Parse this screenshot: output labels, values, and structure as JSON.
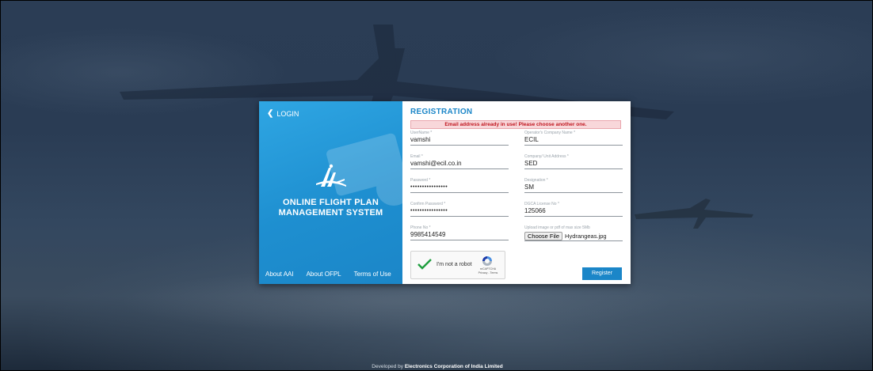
{
  "left": {
    "login_label": "LOGIN",
    "system_title_line1": "ONLINE FLIGHT PLAN",
    "system_title_line2": "MANAGEMENT SYSTEM",
    "links": [
      "About AAI",
      "About OFPL",
      "Terms of Use"
    ]
  },
  "form": {
    "title": "REGISTRATION",
    "error": "Email address already in use! Please choose another one.",
    "fields": {
      "username": {
        "label": "UserName *",
        "value": "vamshi"
      },
      "company_name": {
        "label": "Operator's Company Name *",
        "value": "ECIL"
      },
      "email": {
        "label": "Email *",
        "value": "vamshi@ecil.co.in"
      },
      "company_address": {
        "label": "Company/ Unit Address *",
        "value": "SED"
      },
      "password": {
        "label": "Password *",
        "value": "••••••••••••••••"
      },
      "designation": {
        "label": "Designation *",
        "value": "SM"
      },
      "confirm_password": {
        "label": "Confirm Password *",
        "value": "••••••••••••••••"
      },
      "dgca_license": {
        "label": "DGCA License No *",
        "value": "125066"
      },
      "phone": {
        "label": "Phone No *",
        "value": "9985414549"
      },
      "upload": {
        "label": "Upload image or pdf of max size 5Mb",
        "button": "Choose File",
        "file_name": "Hydrangeas.jpg"
      }
    },
    "captcha": {
      "label": "I'm not a robot",
      "brand": "reCAPTCHA",
      "links": "Privacy - Terms"
    },
    "register_label": "Register"
  },
  "footer": {
    "prefix": "Developed by",
    "org": "Electronics Corporation of India Limited"
  },
  "colors": {
    "accent": "#1b86c8",
    "error_text": "#c0151e",
    "error_bg": "#f8d7da"
  },
  "icons": {
    "login": "chevron-left-icon",
    "logo": "aai-logo",
    "captcha_check": "checkmark-icon",
    "captcha_logo": "recaptcha-icon"
  }
}
